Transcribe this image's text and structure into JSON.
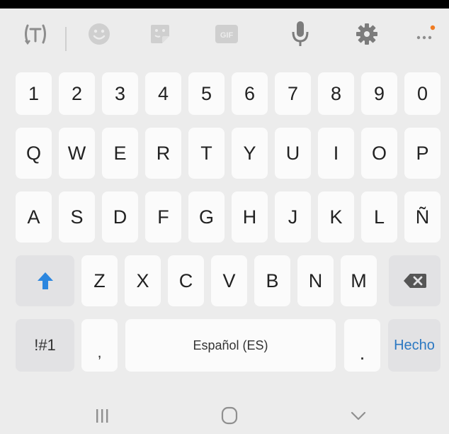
{
  "toolbar": {
    "icons": [
      "text-translate-icon",
      "emoji-icon",
      "sticker-icon",
      "gif-icon",
      "microphone-icon",
      "settings-icon",
      "more-icon"
    ],
    "gif_label": "GIF",
    "accent_dot": "#f07b22"
  },
  "keys": {
    "row1": [
      "1",
      "2",
      "3",
      "4",
      "5",
      "6",
      "7",
      "8",
      "9",
      "0"
    ],
    "row2": [
      "Q",
      "W",
      "E",
      "R",
      "T",
      "Y",
      "U",
      "I",
      "O",
      "P"
    ],
    "row3": [
      "A",
      "S",
      "D",
      "F",
      "G",
      "H",
      "J",
      "K",
      "L",
      "Ñ"
    ],
    "row4": [
      "Z",
      "X",
      "C",
      "V",
      "B",
      "N",
      "M"
    ],
    "symbols": "!#1",
    "comma": ",",
    "space": "Español (ES)",
    "period": ".",
    "done": "Hecho"
  },
  "colors": {
    "shift": "#2b86df",
    "done": "#2b78c2"
  },
  "navbar": {
    "icons": [
      "recent-apps-icon",
      "home-icon",
      "back-icon"
    ]
  }
}
